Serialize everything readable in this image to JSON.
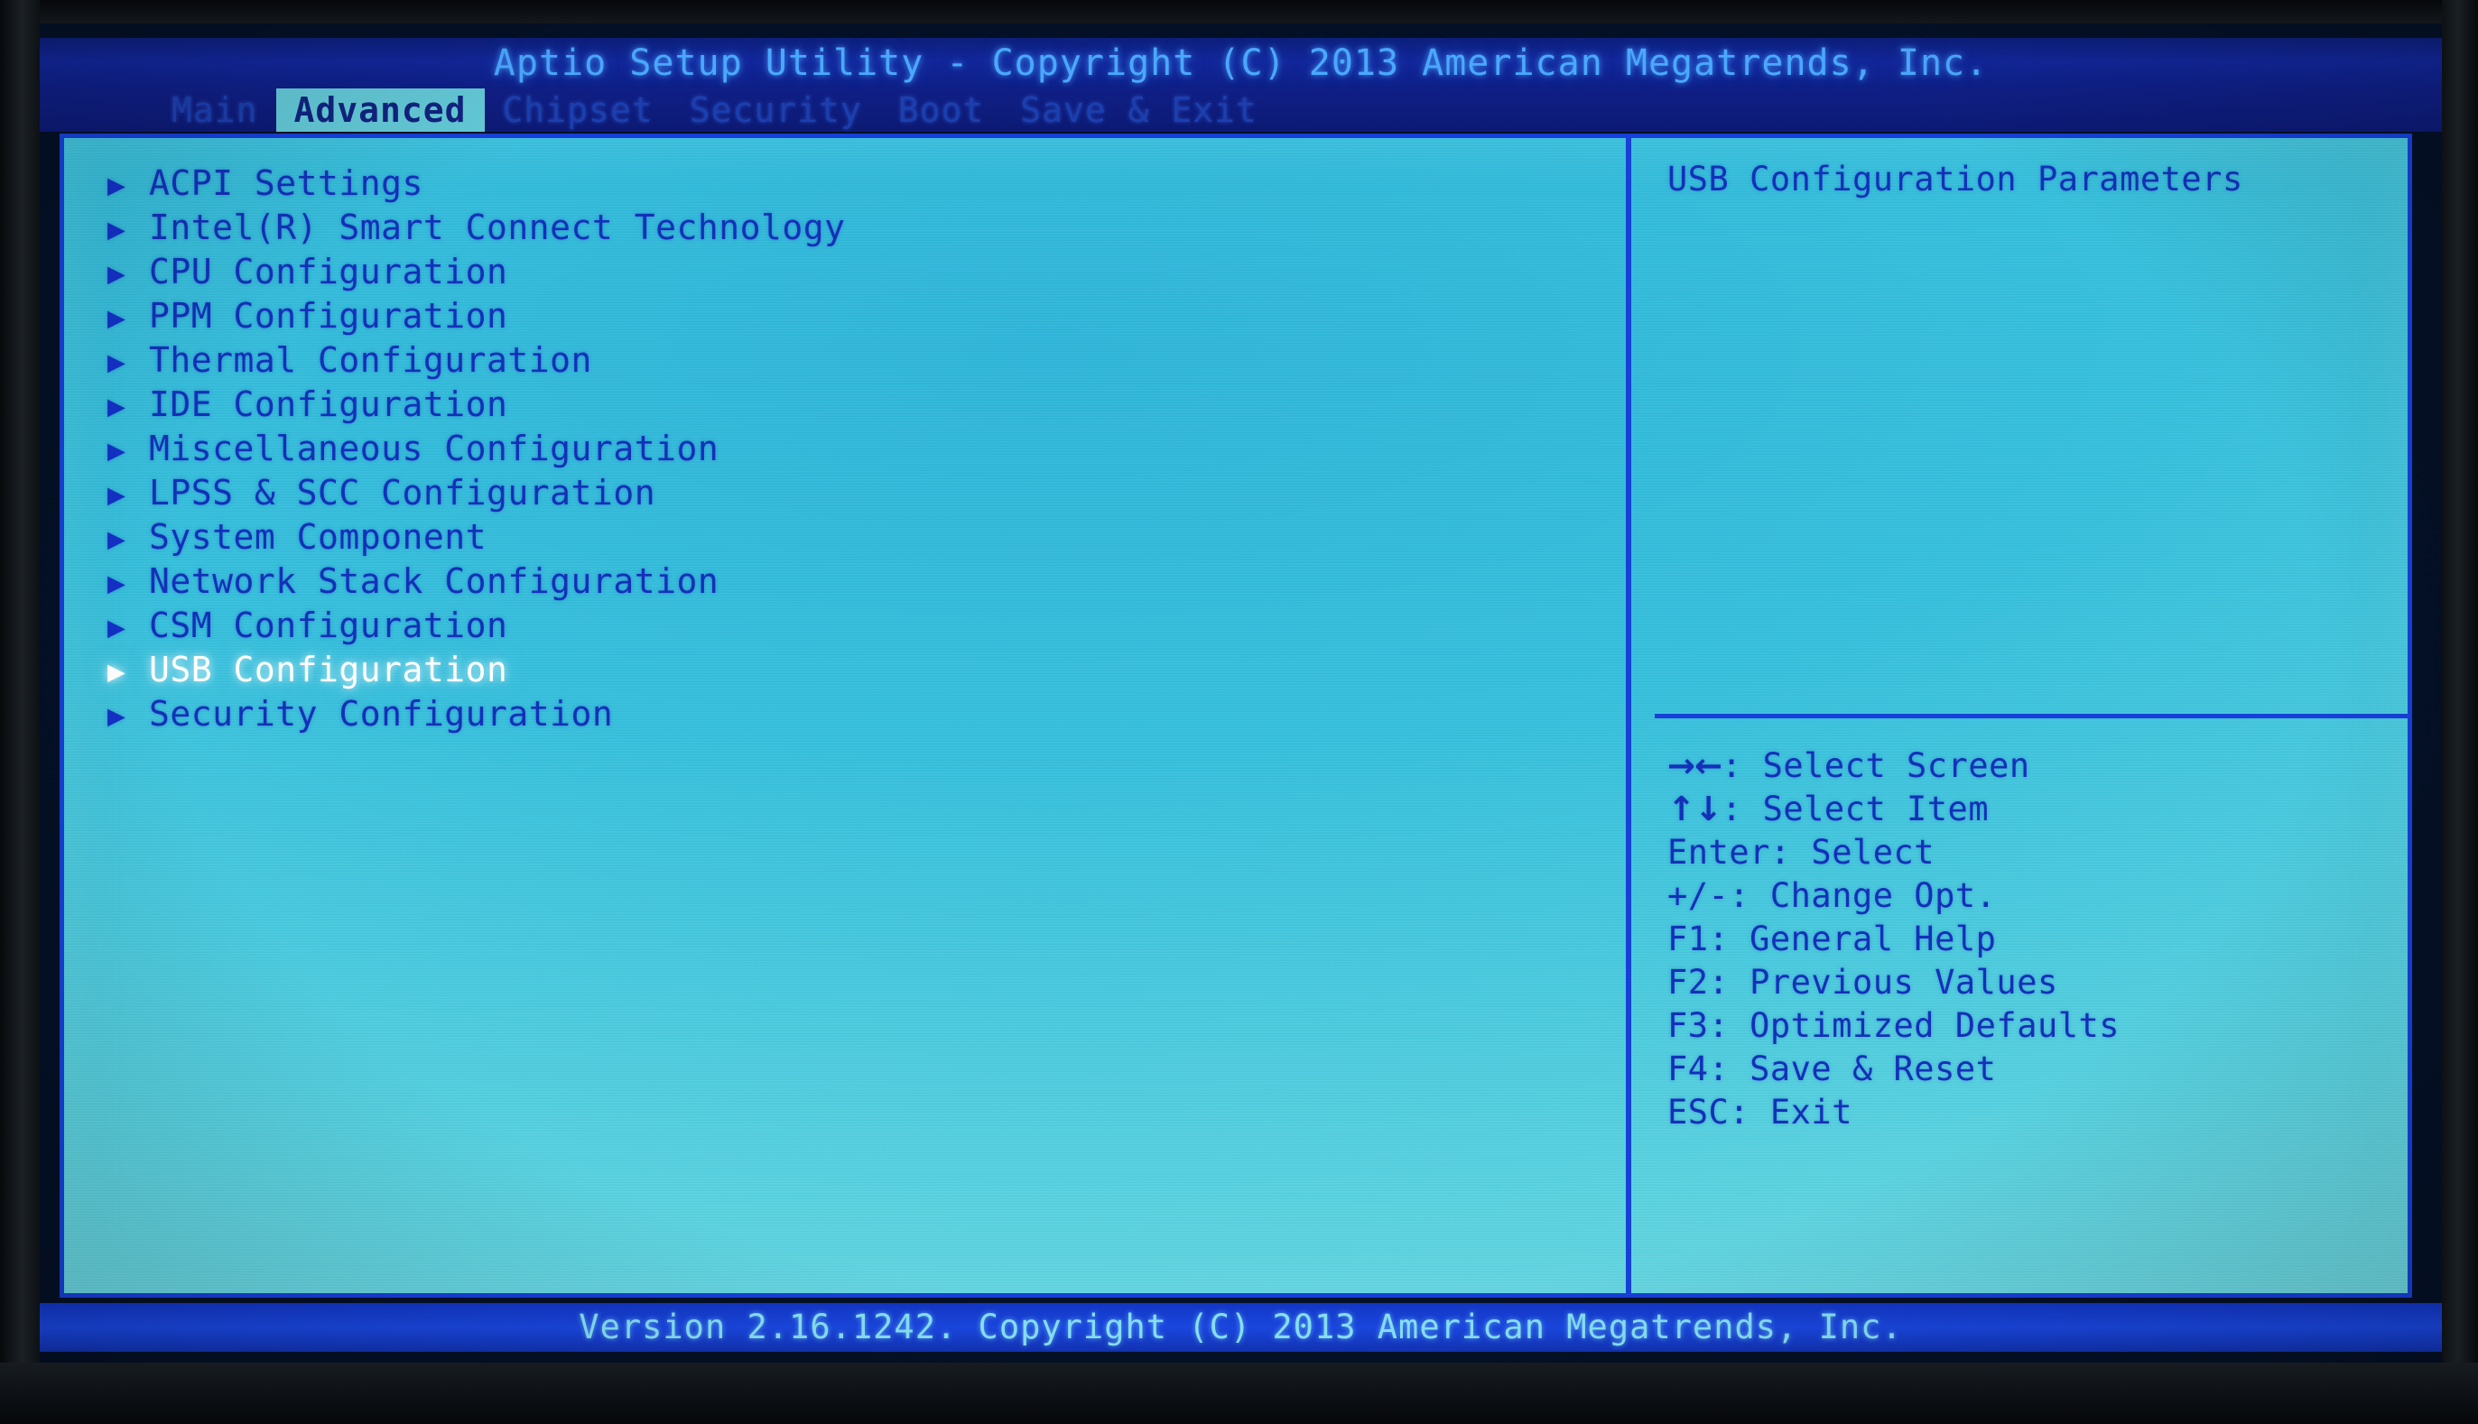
{
  "title_bar": {
    "text": "Aptio Setup Utility - Copyright (C) 2013 American Megatrends, Inc."
  },
  "tabs": [
    {
      "label": "Main",
      "active": false
    },
    {
      "label": "Advanced",
      "active": true
    },
    {
      "label": "Chipset",
      "active": false
    },
    {
      "label": "Security",
      "active": false
    },
    {
      "label": "Boot",
      "active": false
    },
    {
      "label": "Save & Exit",
      "active": false
    }
  ],
  "menu": {
    "bullet_glyph": "▶",
    "items": [
      {
        "label": "ACPI Settings",
        "selected": false
      },
      {
        "label": "Intel(R) Smart Connect Technology",
        "selected": false
      },
      {
        "label": "CPU Configuration",
        "selected": false
      },
      {
        "label": "PPM Configuration",
        "selected": false
      },
      {
        "label": "Thermal Configuration",
        "selected": false
      },
      {
        "label": "IDE Configuration",
        "selected": false
      },
      {
        "label": "Miscellaneous Configuration",
        "selected": false
      },
      {
        "label": "LPSS & SCC Configuration",
        "selected": false
      },
      {
        "label": "System Component",
        "selected": false
      },
      {
        "label": "Network Stack Configuration",
        "selected": false
      },
      {
        "label": "CSM Configuration",
        "selected": false
      },
      {
        "label": "USB Configuration",
        "selected": true
      },
      {
        "label": "Security Configuration",
        "selected": false
      }
    ]
  },
  "help": {
    "description": "USB Configuration Parameters",
    "keys": [
      {
        "glyph": "→←",
        "text": ": Select Screen"
      },
      {
        "glyph": "↑↓",
        "text": ": Select Item"
      },
      {
        "glyph": "",
        "text": "Enter: Select"
      },
      {
        "glyph": "",
        "text": "+/-: Change Opt."
      },
      {
        "glyph": "",
        "text": "F1: General Help"
      },
      {
        "glyph": "",
        "text": "F2: Previous Values"
      },
      {
        "glyph": "",
        "text": "F3: Optimized Defaults"
      },
      {
        "glyph": "",
        "text": "F4: Save & Reset"
      },
      {
        "glyph": "",
        "text": "ESC: Exit"
      }
    ]
  },
  "footer": {
    "text": "Version 2.16.1242. Copyright (C) 2013 American Megatrends, Inc."
  },
  "colors": {
    "panel_background": "#36c0dd",
    "border": "#1740d8",
    "text": "#1331b8",
    "selected_text": "#ffffff",
    "tab_active_bg": "#63c8d6",
    "title_bar_bg": "#12269a",
    "title_text": "#4aa8ff",
    "footer_text": "#86e0f4"
  }
}
